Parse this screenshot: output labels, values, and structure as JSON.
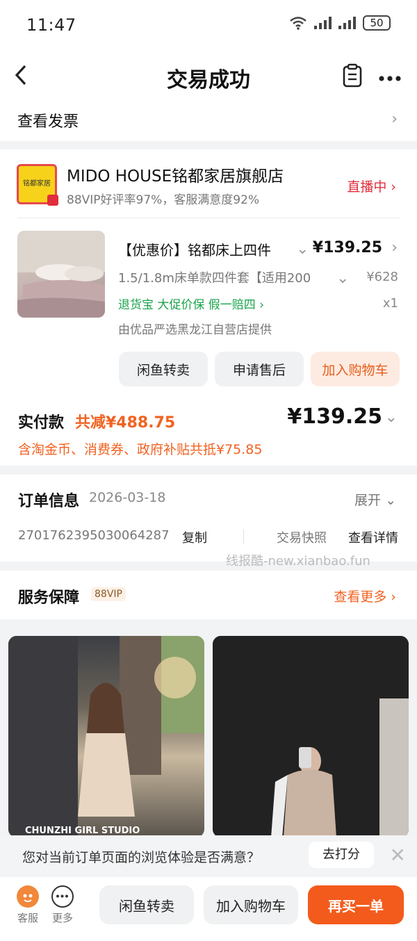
{
  "status_bar": {
    "time": "11:47",
    "battery": "50"
  },
  "nav": {
    "title": "交易成功"
  },
  "invoice": {
    "label": "查看发票"
  },
  "store": {
    "logo_text": "铭都家居",
    "name": "MIDO HOUSE铭都家居旗舰店",
    "subtitle": "88VIP好评率97%，客服满意度92%",
    "live_label": "直播中"
  },
  "product": {
    "title": "【优惠价】铭都床上四件",
    "price": "¥139.25",
    "spec": "1.5/1.8m床单款四件套【适用200",
    "original_price": "¥628",
    "tags": "退货宝 大促价保 假一赔四",
    "quantity": "x1",
    "provider": "由优品严选黑龙江自营店提供",
    "buttons": {
      "resell": "闲鱼转卖",
      "after_sale": "申请售后",
      "add_cart": "加入购物车"
    }
  },
  "payment": {
    "label": "实付款",
    "discount": "共减¥488.75",
    "total": "¥139.25",
    "note": "含淘金币、消费券、政府补贴共抵¥75.85"
  },
  "order": {
    "title": "订单信息",
    "date": "2026-03-18",
    "expand": "展开",
    "number": "2701762395030064287",
    "copy": "复制",
    "snapshot": "交易快照",
    "detail": "查看详情",
    "watermark": "线报酷-new.xianbao.fun"
  },
  "service": {
    "title": "服务保障",
    "badge": "88VIP",
    "more": "查看更多"
  },
  "photos": {
    "caption1": "CHUNZHI GIRL STUDIO"
  },
  "survey": {
    "text": "您对当前订单页面的浏览体验是否满意？",
    "button": "去打分"
  },
  "bottom_bar": {
    "service": "客服",
    "more": "更多",
    "resell": "闲鱼转卖",
    "add_cart": "加入购物车",
    "buy_again": "再买一单"
  },
  "colors": {
    "accent": "#f16222",
    "live_red": "#e02e3c",
    "green": "#1aa34a",
    "logo_yellow": "#f7d21a"
  }
}
